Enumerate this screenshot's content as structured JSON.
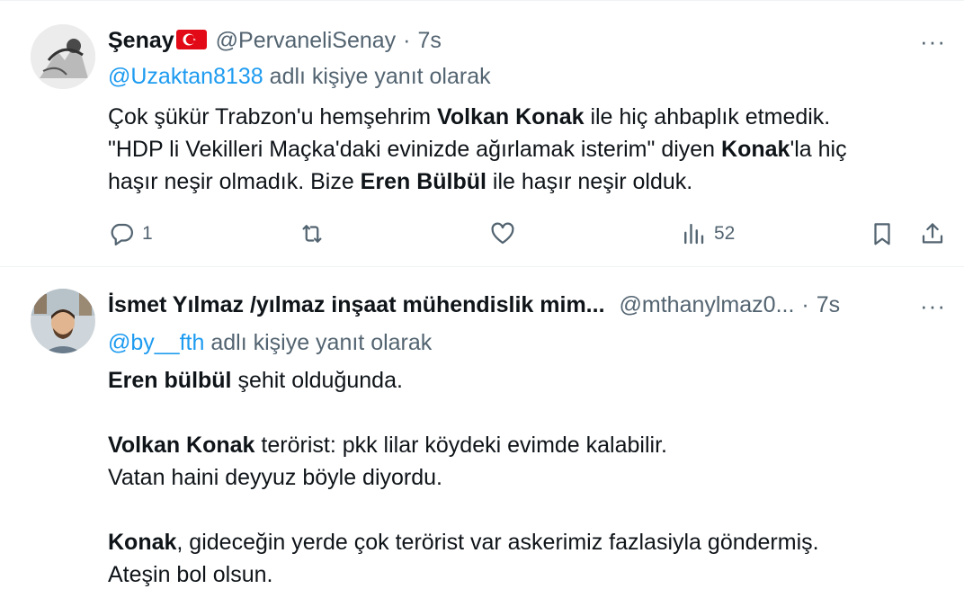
{
  "tweets": [
    {
      "display_name": "Şenay",
      "handle": "@PervaneliSenay",
      "separator": "·",
      "time": "7s",
      "reply_to": "@Uzaktan8138",
      "reply_suffix": "adlı kişiye yanıt olarak",
      "lines": [
        [
          {
            "t": "Çok şükür Trabzon'u hemşehrim ",
            "b": false
          },
          {
            "t": "Volkan Konak",
            "b": true
          },
          {
            "t": " ile hiç ahbaplık etmedik.",
            "b": false
          }
        ],
        [
          {
            "t": "\"HDP li Vekilleri Maçka'daki evinizde ağırlamak isterim\" diyen ",
            "b": false
          },
          {
            "t": "Konak",
            "b": true
          },
          {
            "t": "'la hiç",
            "b": false
          }
        ],
        [
          {
            "t": "haşır neşir olmadık. Bize ",
            "b": false
          },
          {
            "t": "Eren Bülbül",
            "b": true
          },
          {
            "t": " ile haşır neşir olduk.",
            "b": false
          }
        ]
      ],
      "actions": {
        "replies": "1",
        "views": "52"
      },
      "more": "···"
    },
    {
      "display_name": "İsmet Yılmaz /yılmaz inşaat mühendislik mim...",
      "handle": "@mthanylmaz0...",
      "separator": "·",
      "time": "7s",
      "reply_to": "@by__fth",
      "reply_suffix": "adlı kişiye yanıt olarak",
      "lines": [
        [
          {
            "t": "Eren bülbül",
            "b": true
          },
          {
            "t": " şehit olduğunda.",
            "b": false
          }
        ],
        [],
        [
          {
            "t": "Volkan Konak",
            "b": true
          },
          {
            "t": " terörist: pkk lilar köydeki evimde kalabilir.",
            "b": false
          }
        ],
        [
          {
            "t": "Vatan haini deyyuz böyle diyordu.",
            "b": false
          }
        ],
        [],
        [
          {
            "t": "Konak",
            "b": true
          },
          {
            "t": ", gideceğin yerde çok terörist var askerimiz fazlasiyla göndermiş.",
            "b": false
          }
        ],
        [
          {
            "t": "Ateşin bol olsun.",
            "b": false
          }
        ]
      ],
      "more": "···"
    }
  ],
  "colors": {
    "link": "#1d9bf0",
    "muted": "#536471",
    "text": "#0f1419",
    "border": "#eff3f4",
    "flag": "#e30a17"
  },
  "icons": [
    "reply-icon",
    "retweet-icon",
    "like-icon",
    "views-icon",
    "bookmark-icon",
    "share-icon",
    "turkish-flag-icon"
  ]
}
